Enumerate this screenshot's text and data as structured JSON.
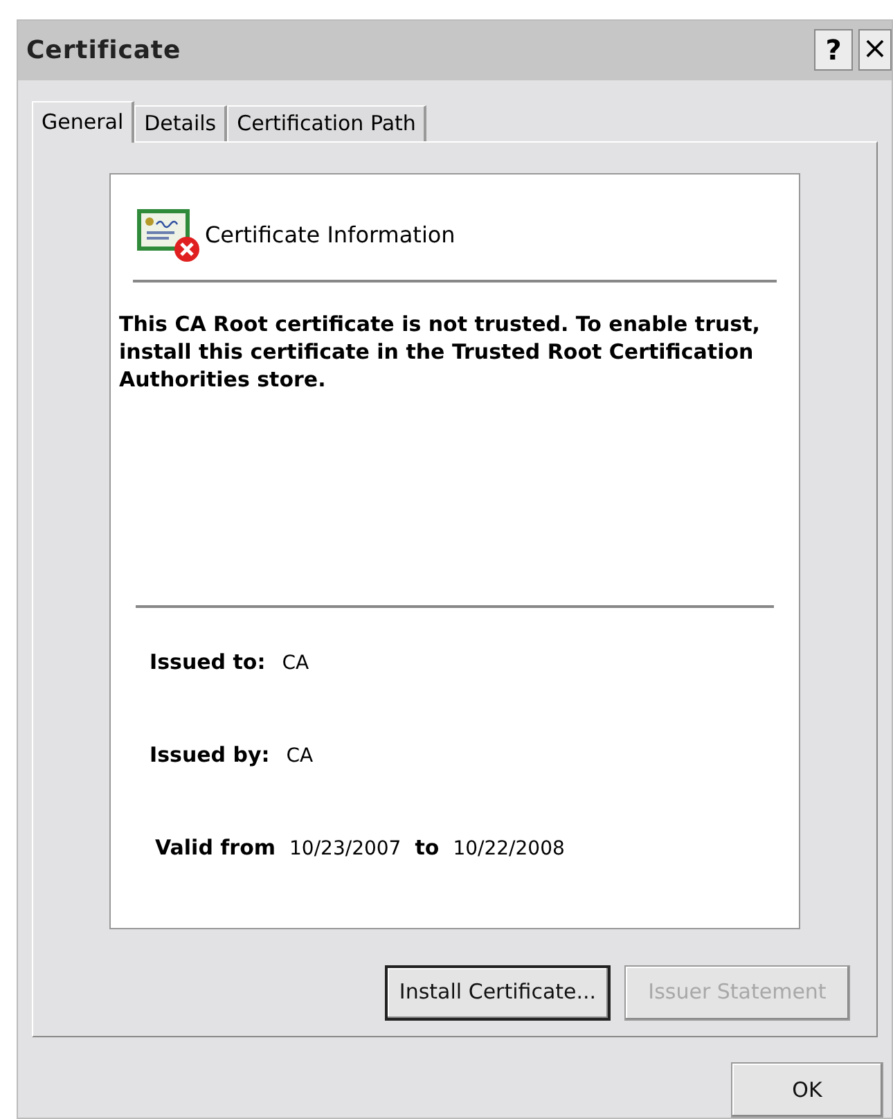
{
  "window": {
    "title": "Certificate",
    "help_button": "?",
    "close_button": "×"
  },
  "tabs": [
    {
      "label": "General",
      "selected": true
    },
    {
      "label": "Details",
      "selected": false
    },
    {
      "label": "Certification Path",
      "selected": false
    }
  ],
  "info": {
    "heading": "Certificate Information",
    "trusted": false,
    "message": "This CA Root certificate is not trusted. To enable trust, install this certificate in the Trusted Root Certification Authorities store."
  },
  "fields": [
    {
      "kind": "single",
      "label": "Issued to:",
      "value": "CA"
    },
    {
      "kind": "single",
      "label": "Issued by:",
      "value": "CA"
    },
    {
      "kind": "range",
      "label": "Valid from",
      "value": "10/23/2007",
      "joiner": "to",
      "end": "10/22/2008"
    }
  ],
  "panel_buttons": [
    {
      "label": "Install Certificate...",
      "disabled": false,
      "default": true
    },
    {
      "label": "Issuer Statement",
      "disabled": true,
      "default": false
    }
  ],
  "footer_buttons": [
    {
      "label": "OK",
      "disabled": false,
      "default": false
    }
  ]
}
